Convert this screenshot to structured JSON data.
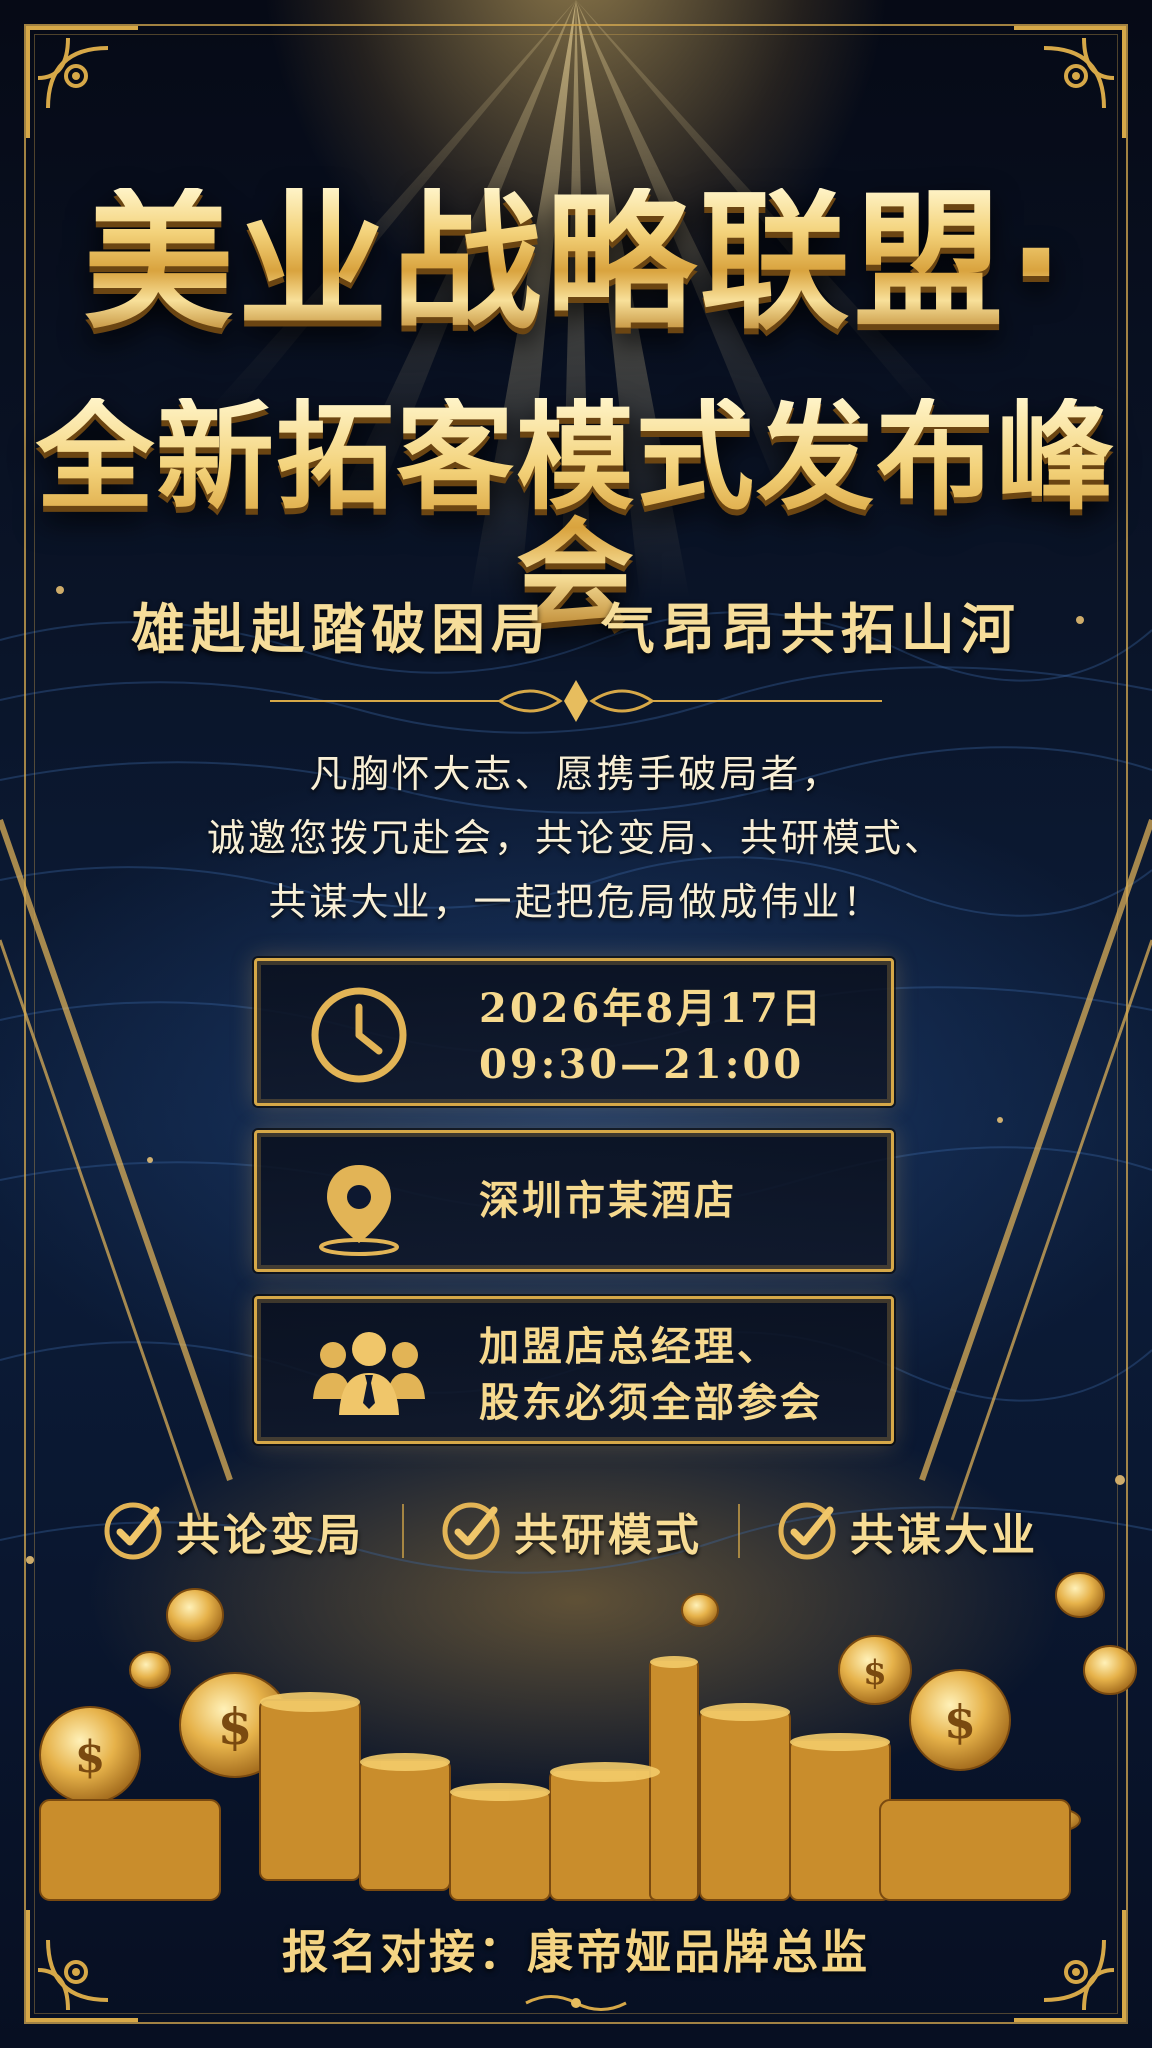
{
  "poster": {
    "title_line1": "美业战略联盟·",
    "title_line2": "全新拓客模式发布峰会",
    "subtitle": "雄赳赳踏破困局  气昂昂共拓山河",
    "intro_lines": [
      "凡胸怀大志、愿携手破局者，",
      "诚邀您拨冗赴会，共论变局、共研模式、",
      "共谋大业，一起把危局做成伟业！"
    ],
    "date_box": {
      "icon": "clock-icon",
      "line1": "2026年8月17日",
      "line2": "09:30—21:00"
    },
    "location_box": {
      "icon": "location-pin-icon",
      "text": "深圳市某酒店"
    },
    "attendee_box": {
      "icon": "people-group-icon",
      "line1": "加盟店总经理、",
      "line2": "股东必须全部参会"
    },
    "features": [
      {
        "icon": "check-circle-icon",
        "label": "共论变局"
      },
      {
        "icon": "check-circle-icon",
        "label": "共研模式"
      },
      {
        "icon": "check-circle-icon",
        "label": "共谋大业"
      }
    ],
    "footer": "报名对接：康帝娅品牌总监",
    "colors": {
      "gold": "#d6a848",
      "light_gold": "#f6d98e",
      "navy": "#0c1d3a"
    }
  }
}
